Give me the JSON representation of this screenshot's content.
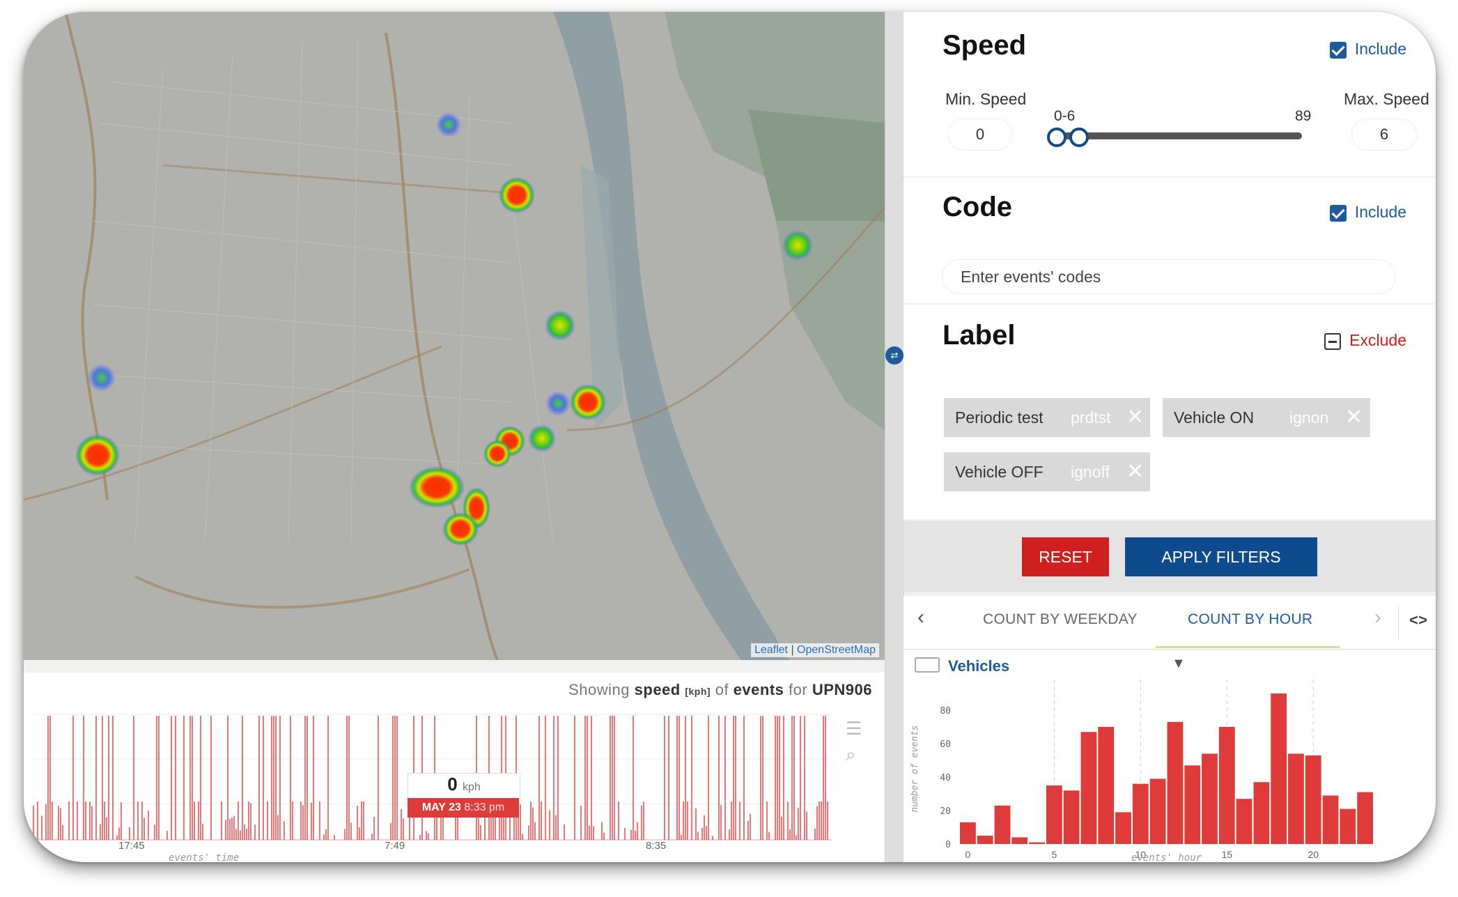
{
  "map": {
    "attribution_leaflet": "Leaflet",
    "attribution_sep": "|",
    "attribution_osm": "OpenStreetMap"
  },
  "timeline": {
    "title_prefix": "Showing",
    "title_measure": "speed",
    "title_unit": "[kph]",
    "title_of": "of",
    "title_events": "events",
    "title_for": "for",
    "title_vehicle": "UPN906",
    "x_ticks": [
      "17:45",
      "7:49",
      "8:35"
    ],
    "x_label": "events' time",
    "tooltip_value": "0",
    "tooltip_unit": "kph",
    "tooltip_date": "MAY 23",
    "tooltip_time": "8:33 pm",
    "bar_color": "#e03b3b"
  },
  "filters": {
    "speed": {
      "title": "Speed",
      "include_label": "Include",
      "min_label": "Min. Speed",
      "max_label": "Max. Speed",
      "min_value": "0",
      "max_value": "6",
      "range_label": "0-6",
      "range_max": "89"
    },
    "code": {
      "title": "Code",
      "include_label": "Include",
      "placeholder": "Enter events' codes"
    },
    "label": {
      "title": "Label",
      "exclude_label": "Exclude",
      "chips": [
        {
          "name": "Periodic test",
          "code": "prdtst"
        },
        {
          "name": "Vehicle ON",
          "code": "ignon"
        },
        {
          "name": "Vehicle OFF",
          "code": "ignoff"
        }
      ]
    },
    "buttons": {
      "reset": "RESET",
      "apply": "APPLY FILTERS"
    }
  },
  "tabs": {
    "weekday": "COUNT BY WEEKDAY",
    "hour": "COUNT BY HOUR",
    "prev": "‹",
    "next": "›",
    "code_toggle": "<>"
  },
  "vehicles_select": "Vehicles",
  "chart_data": {
    "type": "bar",
    "xlabel": "events' hour",
    "ylabel": "number of events",
    "x_ticks": [
      0,
      5,
      10,
      15,
      20
    ],
    "y_ticks": [
      0,
      20,
      40,
      60,
      80
    ],
    "ylim": [
      0,
      90
    ],
    "categories": [
      0,
      1,
      2,
      3,
      4,
      5,
      6,
      7,
      8,
      9,
      10,
      11,
      12,
      13,
      14,
      15,
      16,
      17,
      18,
      19,
      20,
      21,
      22,
      23
    ],
    "values": [
      13,
      5,
      23,
      4,
      1,
      35,
      32,
      67,
      70,
      19,
      36,
      39,
      73,
      47,
      54,
      70,
      27,
      37,
      90,
      54,
      53,
      29,
      21,
      31
    ],
    "bar_color": "#e03b3b",
    "grid_dashed_x": [
      5,
      10,
      15,
      20
    ]
  }
}
